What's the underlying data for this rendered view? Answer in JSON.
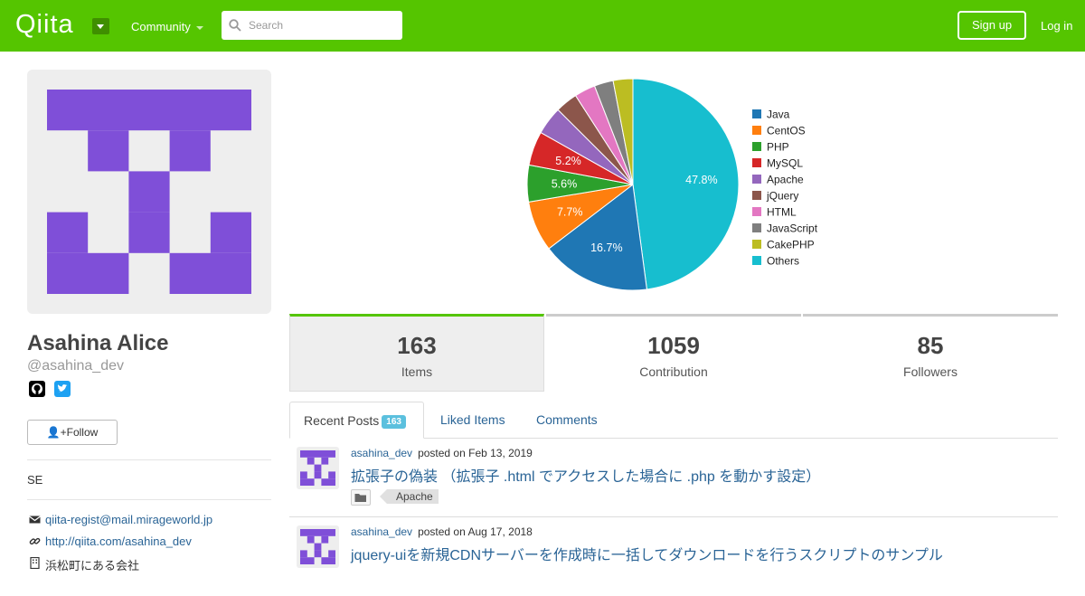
{
  "header": {
    "logo": "Qiita",
    "community_label": "Community",
    "search_placeholder": "Search",
    "signup_label": "Sign up",
    "login_label": "Log in",
    "brand_color": "#55c500"
  },
  "profile": {
    "name": "Asahina Alice",
    "handle": "@asahina_dev",
    "follow_label": "Follow",
    "bio": "SE",
    "email": "qiita-regist@mail.mirageworld.jp",
    "website": "http://qiita.com/asahina_dev",
    "organization": "浜松町にある会社",
    "avatar_color": "#7f4fd8",
    "social": [
      "github-icon",
      "twitter-icon"
    ]
  },
  "chart_data": {
    "type": "pie",
    "categories": [
      "Java",
      "CentOS",
      "PHP",
      "MySQL",
      "Apache",
      "jQuery",
      "HTML",
      "JavaScript",
      "CakePHP",
      "Others"
    ],
    "values": [
      16.7,
      7.7,
      5.6,
      5.2,
      4.3,
      3.4,
      3.2,
      2.9,
      3.0,
      47.8
    ],
    "data_labels": [
      "16.7%",
      "7.7%",
      "5.6%",
      "5.2%",
      "",
      "",
      "",
      "",
      "",
      "47.8%"
    ],
    "colors": [
      "#1f77b4",
      "#ff7f0e",
      "#2ca02c",
      "#d62728",
      "#9467bd",
      "#8c564b",
      "#e377c2",
      "#7f7f7f",
      "#bcbd22",
      "#17becf"
    ],
    "legend_position": "right"
  },
  "stats": [
    {
      "value": "163",
      "label": "Items"
    },
    {
      "value": "1059",
      "label": "Contribution"
    },
    {
      "value": "85",
      "label": "Followers"
    }
  ],
  "tabs": [
    {
      "label": "Recent Posts",
      "badge": "163"
    },
    {
      "label": "Liked Items"
    },
    {
      "label": "Comments"
    }
  ],
  "posts": [
    {
      "user": "asahina_dev",
      "date": "posted on Feb 13, 2019",
      "title": "拡張子の偽装 （拡張子 .html でアクセスした場合に .php を動かす設定）",
      "tags": [
        "Apache"
      ]
    },
    {
      "user": "asahina_dev",
      "date": "posted on Aug 17, 2018",
      "title": "jquery-uiを新規CDNサーバーを作成時に一括してダウンロードを行うスクリプトのサンプル",
      "tags": []
    }
  ]
}
